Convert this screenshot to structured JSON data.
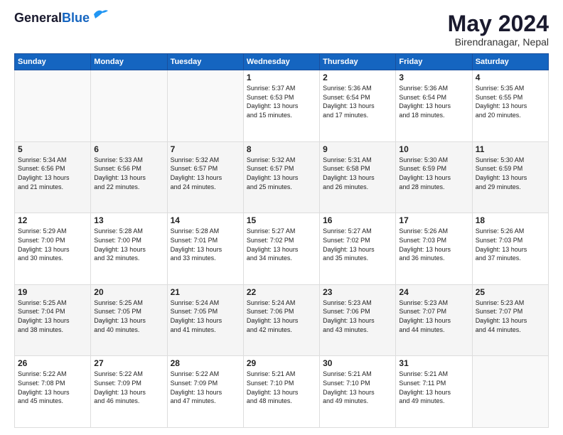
{
  "header": {
    "logo_line1": "General",
    "logo_line2": "Blue",
    "month": "May 2024",
    "location": "Birendranagar, Nepal"
  },
  "weekdays": [
    "Sunday",
    "Monday",
    "Tuesday",
    "Wednesday",
    "Thursday",
    "Friday",
    "Saturday"
  ],
  "weeks": [
    [
      {
        "day": "",
        "text": ""
      },
      {
        "day": "",
        "text": ""
      },
      {
        "day": "",
        "text": ""
      },
      {
        "day": "1",
        "text": "Sunrise: 5:37 AM\nSunset: 6:53 PM\nDaylight: 13 hours\nand 15 minutes."
      },
      {
        "day": "2",
        "text": "Sunrise: 5:36 AM\nSunset: 6:54 PM\nDaylight: 13 hours\nand 17 minutes."
      },
      {
        "day": "3",
        "text": "Sunrise: 5:36 AM\nSunset: 6:54 PM\nDaylight: 13 hours\nand 18 minutes."
      },
      {
        "day": "4",
        "text": "Sunrise: 5:35 AM\nSunset: 6:55 PM\nDaylight: 13 hours\nand 20 minutes."
      }
    ],
    [
      {
        "day": "5",
        "text": "Sunrise: 5:34 AM\nSunset: 6:56 PM\nDaylight: 13 hours\nand 21 minutes."
      },
      {
        "day": "6",
        "text": "Sunrise: 5:33 AM\nSunset: 6:56 PM\nDaylight: 13 hours\nand 22 minutes."
      },
      {
        "day": "7",
        "text": "Sunrise: 5:32 AM\nSunset: 6:57 PM\nDaylight: 13 hours\nand 24 minutes."
      },
      {
        "day": "8",
        "text": "Sunrise: 5:32 AM\nSunset: 6:57 PM\nDaylight: 13 hours\nand 25 minutes."
      },
      {
        "day": "9",
        "text": "Sunrise: 5:31 AM\nSunset: 6:58 PM\nDaylight: 13 hours\nand 26 minutes."
      },
      {
        "day": "10",
        "text": "Sunrise: 5:30 AM\nSunset: 6:59 PM\nDaylight: 13 hours\nand 28 minutes."
      },
      {
        "day": "11",
        "text": "Sunrise: 5:30 AM\nSunset: 6:59 PM\nDaylight: 13 hours\nand 29 minutes."
      }
    ],
    [
      {
        "day": "12",
        "text": "Sunrise: 5:29 AM\nSunset: 7:00 PM\nDaylight: 13 hours\nand 30 minutes."
      },
      {
        "day": "13",
        "text": "Sunrise: 5:28 AM\nSunset: 7:00 PM\nDaylight: 13 hours\nand 32 minutes."
      },
      {
        "day": "14",
        "text": "Sunrise: 5:28 AM\nSunset: 7:01 PM\nDaylight: 13 hours\nand 33 minutes."
      },
      {
        "day": "15",
        "text": "Sunrise: 5:27 AM\nSunset: 7:02 PM\nDaylight: 13 hours\nand 34 minutes."
      },
      {
        "day": "16",
        "text": "Sunrise: 5:27 AM\nSunset: 7:02 PM\nDaylight: 13 hours\nand 35 minutes."
      },
      {
        "day": "17",
        "text": "Sunrise: 5:26 AM\nSunset: 7:03 PM\nDaylight: 13 hours\nand 36 minutes."
      },
      {
        "day": "18",
        "text": "Sunrise: 5:26 AM\nSunset: 7:03 PM\nDaylight: 13 hours\nand 37 minutes."
      }
    ],
    [
      {
        "day": "19",
        "text": "Sunrise: 5:25 AM\nSunset: 7:04 PM\nDaylight: 13 hours\nand 38 minutes."
      },
      {
        "day": "20",
        "text": "Sunrise: 5:25 AM\nSunset: 7:05 PM\nDaylight: 13 hours\nand 40 minutes."
      },
      {
        "day": "21",
        "text": "Sunrise: 5:24 AM\nSunset: 7:05 PM\nDaylight: 13 hours\nand 41 minutes."
      },
      {
        "day": "22",
        "text": "Sunrise: 5:24 AM\nSunset: 7:06 PM\nDaylight: 13 hours\nand 42 minutes."
      },
      {
        "day": "23",
        "text": "Sunrise: 5:23 AM\nSunset: 7:06 PM\nDaylight: 13 hours\nand 43 minutes."
      },
      {
        "day": "24",
        "text": "Sunrise: 5:23 AM\nSunset: 7:07 PM\nDaylight: 13 hours\nand 44 minutes."
      },
      {
        "day": "25",
        "text": "Sunrise: 5:23 AM\nSunset: 7:07 PM\nDaylight: 13 hours\nand 44 minutes."
      }
    ],
    [
      {
        "day": "26",
        "text": "Sunrise: 5:22 AM\nSunset: 7:08 PM\nDaylight: 13 hours\nand 45 minutes."
      },
      {
        "day": "27",
        "text": "Sunrise: 5:22 AM\nSunset: 7:09 PM\nDaylight: 13 hours\nand 46 minutes."
      },
      {
        "day": "28",
        "text": "Sunrise: 5:22 AM\nSunset: 7:09 PM\nDaylight: 13 hours\nand 47 minutes."
      },
      {
        "day": "29",
        "text": "Sunrise: 5:21 AM\nSunset: 7:10 PM\nDaylight: 13 hours\nand 48 minutes."
      },
      {
        "day": "30",
        "text": "Sunrise: 5:21 AM\nSunset: 7:10 PM\nDaylight: 13 hours\nand 49 minutes."
      },
      {
        "day": "31",
        "text": "Sunrise: 5:21 AM\nSunset: 7:11 PM\nDaylight: 13 hours\nand 49 minutes."
      },
      {
        "day": "",
        "text": ""
      }
    ]
  ]
}
